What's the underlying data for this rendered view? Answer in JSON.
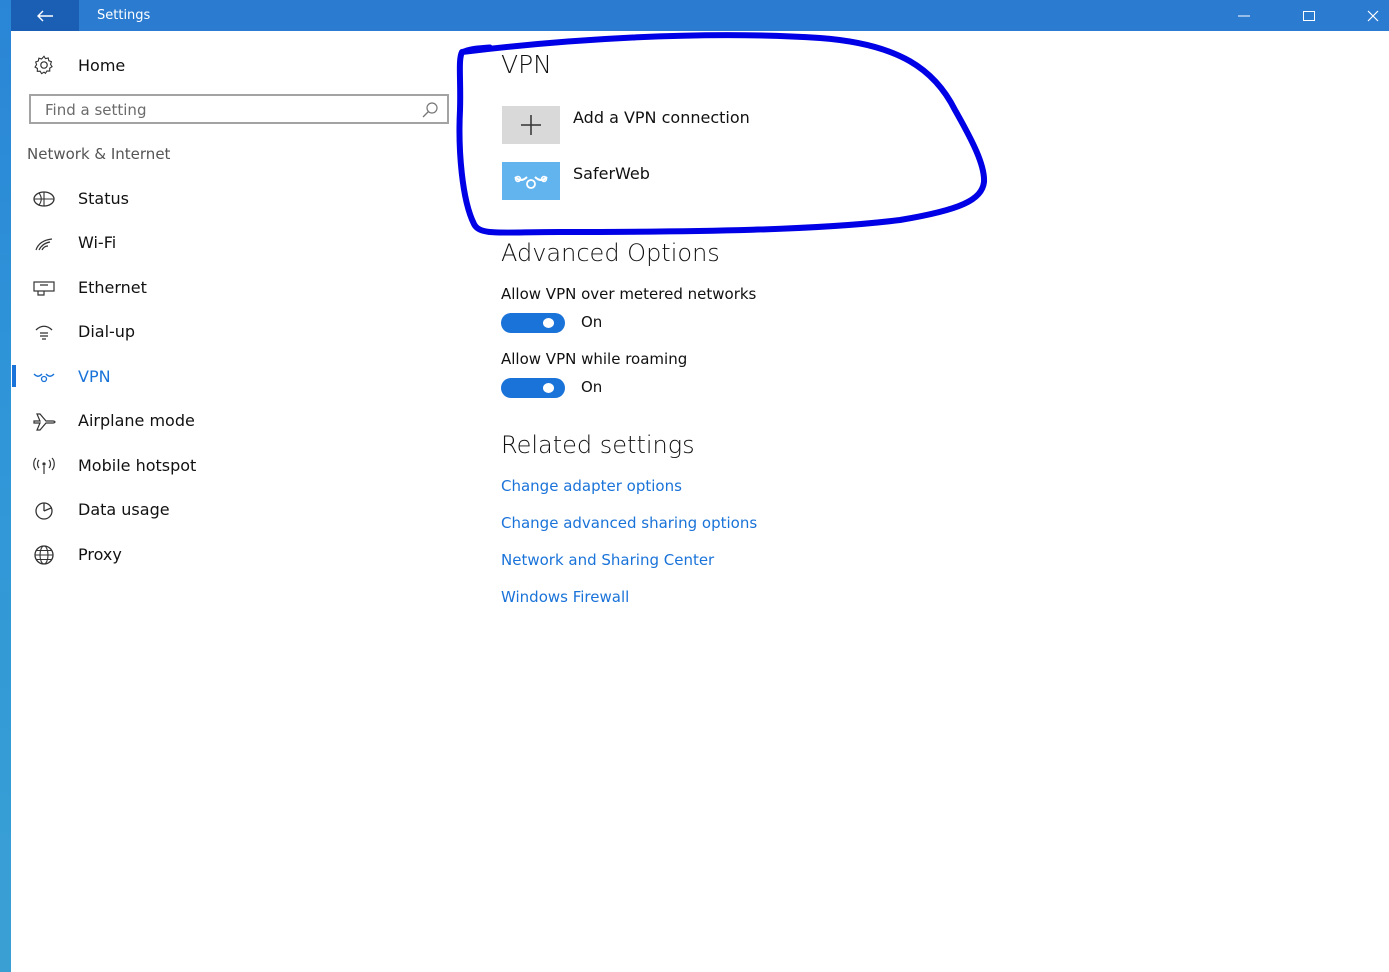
{
  "window": {
    "title": "Settings",
    "controls": [
      "minimize-icon",
      "maximize-icon",
      "close-icon"
    ]
  },
  "sidebar": {
    "home_label": "Home",
    "search": {
      "placeholder": "Find a setting"
    },
    "section_title": "Network & Internet",
    "items": [
      {
        "label": "Status",
        "icon": "status-globe-icon"
      },
      {
        "label": "Wi-Fi",
        "icon": "wifi-icon"
      },
      {
        "label": "Ethernet",
        "icon": "ethernet-icon"
      },
      {
        "label": "Dial-up",
        "icon": "dialup-icon"
      },
      {
        "label": "VPN",
        "icon": "vpn-icon",
        "active": true
      },
      {
        "label": "Airplane mode",
        "icon": "airplane-icon"
      },
      {
        "label": "Mobile hotspot",
        "icon": "hotspot-icon"
      },
      {
        "label": "Data usage",
        "icon": "data-usage-icon"
      },
      {
        "label": "Proxy",
        "icon": "globe-icon"
      }
    ]
  },
  "main": {
    "vpn_heading": "VPN",
    "add_vpn_label": "Add a VPN connection",
    "connections": [
      {
        "name": "SaferWeb"
      }
    ],
    "advanced_heading": "Advanced Options",
    "options": [
      {
        "label": "Allow VPN over metered networks",
        "state": "On",
        "on": true
      },
      {
        "label": "Allow VPN while roaming",
        "state": "On",
        "on": true
      }
    ],
    "related_heading": "Related settings",
    "related_links": [
      "Change adapter options",
      "Change advanced sharing options",
      "Network and Sharing Center",
      "Windows Firewall"
    ]
  },
  "colors": {
    "accent": "#1a73d9",
    "titlebar": "#2b7bd0",
    "annotation": "#0000e6"
  }
}
